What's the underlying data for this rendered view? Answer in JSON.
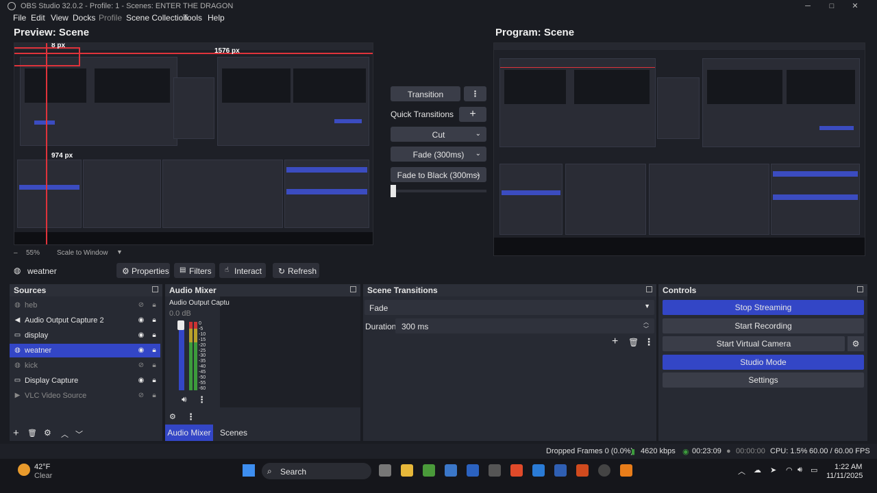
{
  "window": {
    "title": "OBS Studio 32.0.2 - Profile: 1 - Scenes: ENTER THE DRAGON",
    "min": "─",
    "max": "□",
    "close": "✕"
  },
  "menu": [
    "File",
    "Edit",
    "View",
    "Docks",
    "Profile",
    "Scene Collection",
    "Tools",
    "Help"
  ],
  "preview": {
    "title": "Preview: Scene",
    "zoom": "55%",
    "scale_mode": "Scale to Window",
    "measure_top": "8 px",
    "measure_right": "1576 px",
    "measure_bottom": "974 px"
  },
  "program": {
    "title": "Program: Scene"
  },
  "transitions": {
    "transition_label": "Transition",
    "quick_label": "Quick Transitions",
    "quick": [
      "Cut",
      "Fade (300ms)",
      "Fade to Black (300ms)"
    ]
  },
  "toolbar": {
    "source_name": "weatner",
    "properties": "Properties",
    "filters": "Filters",
    "interact": "Interact",
    "refresh": "Refresh"
  },
  "sources": {
    "title": "Sources",
    "items": [
      {
        "name": "heb",
        "icon": "globe-icon"
      },
      {
        "name": "Audio Output Capture 2",
        "icon": "speaker-icon"
      },
      {
        "name": "display",
        "icon": "monitor-icon"
      },
      {
        "name": "weatner",
        "icon": "globe-icon"
      },
      {
        "name": "kick",
        "icon": "globe-icon"
      },
      {
        "name": "Display Capture",
        "icon": "monitor-icon"
      },
      {
        "name": "VLC Video Source",
        "icon": "play-icon"
      }
    ]
  },
  "mixer": {
    "title": "Audio Mixer",
    "channel": "Audio Output Captu",
    "db": "0.0 dB",
    "scale": [
      "0",
      "-5",
      "-10",
      "-15",
      "-20",
      "-25",
      "-30",
      "-35",
      "-40",
      "-45",
      "-50",
      "-55",
      "-60"
    ],
    "tab_mixer": "Audio Mixer",
    "tab_scenes": "Scenes"
  },
  "scene_transitions": {
    "title": "Scene Transitions",
    "selected": "Fade",
    "duration_label": "Duration",
    "duration_value": "300 ms"
  },
  "controls": {
    "title": "Controls",
    "stop_streaming": "Stop Streaming",
    "start_recording": "Start Recording",
    "start_virtual_camera": "Start Virtual Camera",
    "studio_mode": "Studio Mode",
    "settings": "Settings"
  },
  "status": {
    "dropped": "Dropped Frames 0 (0.0%)",
    "kbps": "4620 kbps",
    "stream_time": "00:23:09",
    "rec_time": "00:00:00",
    "cpu": "CPU: 1.5%",
    "fps": "60.00 / 60.00 FPS"
  },
  "taskbar": {
    "weather_temp": "42°F",
    "weather_desc": "Clear",
    "search": "Search",
    "time": "1:22 AM",
    "date": "11/11/2025"
  },
  "colors": {
    "accent_blue": "#3346c6",
    "background": "#1a1c22",
    "panel": "#272a33",
    "measure_red": "#e0333b"
  }
}
